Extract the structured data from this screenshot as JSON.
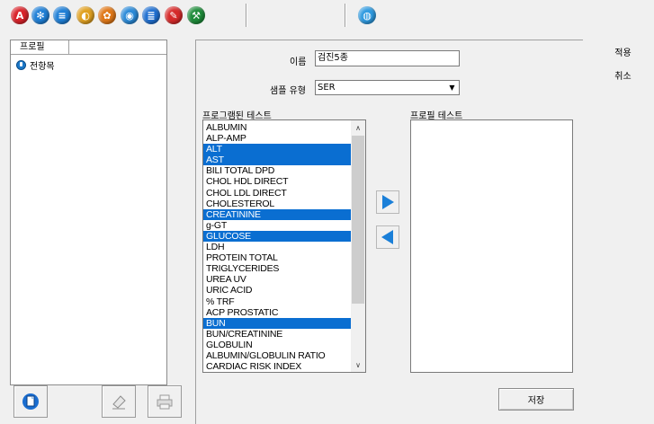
{
  "toolbar": {
    "icons": [
      {
        "name": "alert-icon",
        "color": "#d9232a",
        "glyph": "A"
      },
      {
        "name": "snowflake-icon",
        "color": "#1f7fd6",
        "glyph": "✻"
      },
      {
        "name": "disk-icon",
        "color": "#1f7fd6",
        "glyph": "≡"
      },
      {
        "name": "tube-icon",
        "color": "#e0a020",
        "glyph": "◐"
      },
      {
        "name": "flower-icon",
        "color": "#e07818",
        "glyph": "✿"
      },
      {
        "name": "eye-icon",
        "color": "#2a8ad8",
        "glyph": "◉"
      },
      {
        "name": "stack-icon",
        "color": "#1f6fd0",
        "glyph": "≣"
      },
      {
        "name": "wrench-red-icon",
        "color": "#d62a2a",
        "glyph": "✎"
      },
      {
        "name": "wrench-green-icon",
        "color": "#1e8c3a",
        "glyph": "⚒"
      },
      {
        "name": "globe-icon",
        "color": "#2e9ae0",
        "glyph": "◍"
      }
    ]
  },
  "left": {
    "column_header": "프로필",
    "tree_root": "전항목"
  },
  "form": {
    "name_label": "이름",
    "name_value": "검진5종",
    "sample_type_label": "샘플 유형",
    "sample_type_value": "SER",
    "programmed_tests_label": "프로그램된 테스트",
    "profile_tests_label": "프로필 테스트"
  },
  "programmed_tests": [
    {
      "label": "ALBUMIN",
      "selected": false
    },
    {
      "label": "ALP-AMP",
      "selected": false
    },
    {
      "label": "ALT",
      "selected": true
    },
    {
      "label": "AST",
      "selected": true
    },
    {
      "label": "BILI TOTAL DPD",
      "selected": false
    },
    {
      "label": "CHOL HDL DIRECT",
      "selected": false
    },
    {
      "label": "CHOL LDL DIRECT",
      "selected": false
    },
    {
      "label": "CHOLESTEROL",
      "selected": false
    },
    {
      "label": "CREATININE",
      "selected": true
    },
    {
      "label": "g-GT",
      "selected": false
    },
    {
      "label": "GLUCOSE",
      "selected": true
    },
    {
      "label": "LDH",
      "selected": false
    },
    {
      "label": "PROTEIN TOTAL",
      "selected": false
    },
    {
      "label": "TRIGLYCERIDES",
      "selected": false
    },
    {
      "label": "UREA UV",
      "selected": false
    },
    {
      "label": "URIC ACID",
      "selected": false
    },
    {
      "label": "% TRF",
      "selected": false
    },
    {
      "label": "ACP PROSTATIC",
      "selected": false
    },
    {
      "label": "BUN",
      "selected": true
    },
    {
      "label": "BUN/CREATININE",
      "selected": false
    },
    {
      "label": "GLOBULIN",
      "selected": false
    },
    {
      "label": "ALBUMIN/GLOBULIN RATIO",
      "selected": false
    },
    {
      "label": "CARDIAC RISK INDEX",
      "selected": false
    }
  ],
  "profile_tests": [],
  "buttons": {
    "apply": "적용",
    "cancel": "취소",
    "save": "저장"
  },
  "colors": {
    "selection": "#0a6ed1",
    "arrow": "#1a7fd8"
  }
}
